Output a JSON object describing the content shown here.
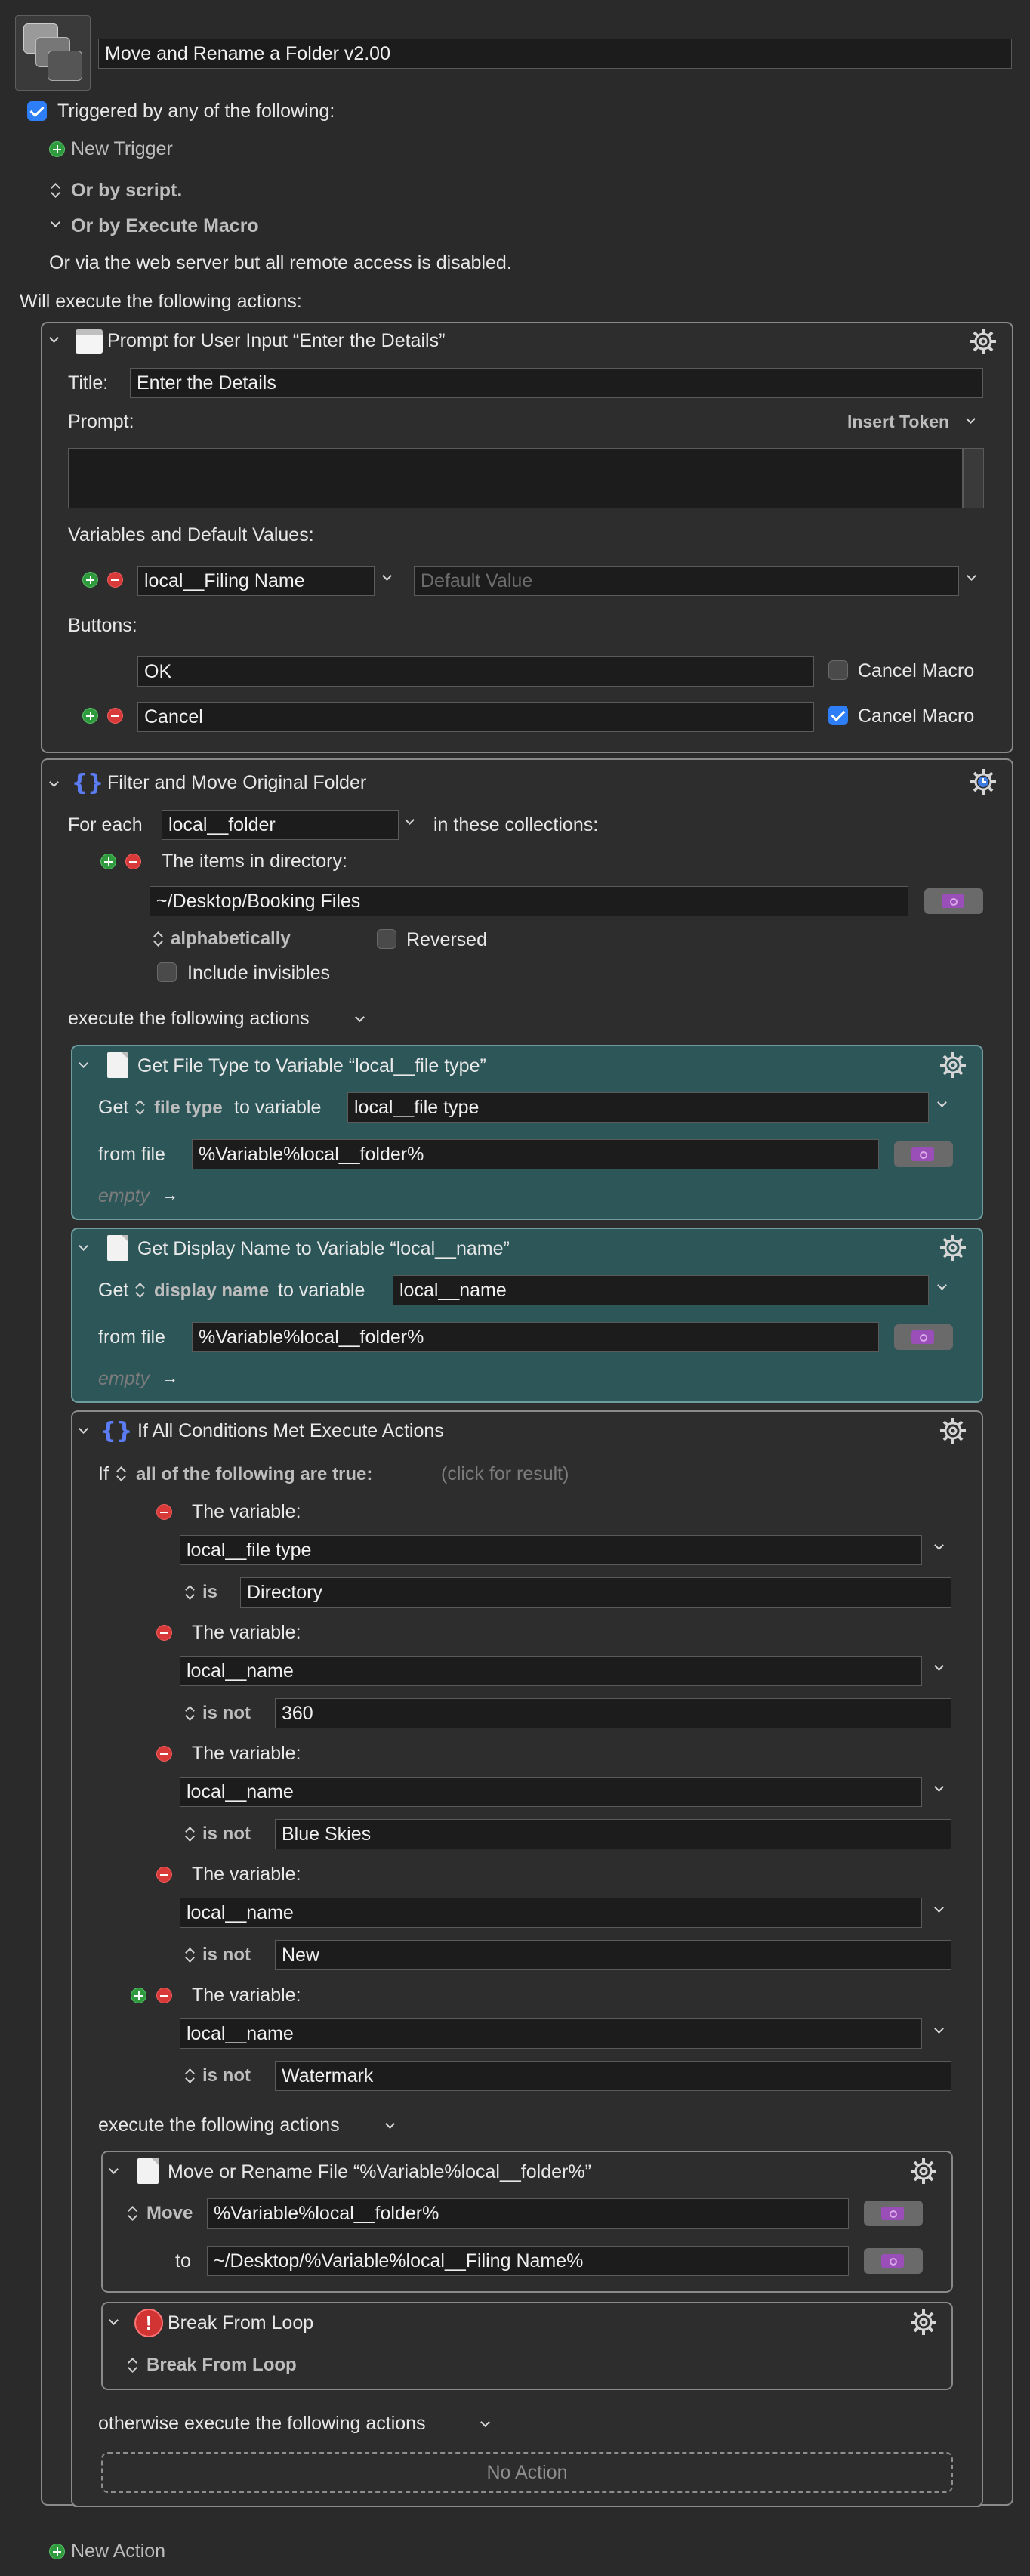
{
  "macro": {
    "name": "Move and Rename a Folder v2.00",
    "triggered_label": "Triggered by any of the following:",
    "new_trigger": "New Trigger",
    "or_by_script": "Or by script.",
    "or_by_execute_macro": "Or by Execute Macro",
    "web_server_note": "Or via the web server but all remote access is disabled.",
    "will_execute": "Will execute the following actions:",
    "new_action": "New Action"
  },
  "prompt_action": {
    "title": "Prompt for User Input “Enter the Details”",
    "title_label": "Title:",
    "title_value": "Enter the Details",
    "prompt_label": "Prompt:",
    "insert_token": "Insert Token",
    "vars_label": "Variables and Default Values:",
    "var_name": "local__Filing Name",
    "default_placeholder": "Default Value",
    "buttons_label": "Buttons:",
    "button1": "OK",
    "button2": "Cancel",
    "cancel_macro": "Cancel Macro",
    "cancel_macro_2": "Cancel Macro"
  },
  "foreach_action": {
    "title": "Filter and Move Original Folder",
    "for_each": "For each",
    "var": "local__folder",
    "in_collections": "in these collections:",
    "items_in_dir": "The items in directory:",
    "dir_path": "~/Desktop/Booking Files",
    "sort": "alphabetically",
    "reversed": "Reversed",
    "include_invisibles": "Include invisibles",
    "execute_following": "execute the following actions"
  },
  "get_file_type": {
    "title": "Get File Type to Variable “local__file type”",
    "get": "Get",
    "attr": "file type",
    "to_variable": "to variable",
    "var": "local__file type",
    "from_file": "from file",
    "file_value": "%Variable%local__folder%",
    "empty": "empty"
  },
  "get_display_name": {
    "title": "Get Display Name to Variable “local__name”",
    "get": "Get",
    "attr": "display name",
    "to_variable": "to variable",
    "var": "local__name",
    "from_file": "from file",
    "file_value": "%Variable%local__folder%",
    "empty": "empty"
  },
  "if_action": {
    "title": "If All Conditions Met Execute Actions",
    "if": "If",
    "all_following": "all of the following are true:",
    "click_result": "(click for result)",
    "the_variable": "The variable:",
    "conditions": [
      {
        "var": "local__file type",
        "op": "is",
        "value": "Directory"
      },
      {
        "var": "local__name",
        "op": "is not",
        "value": "360"
      },
      {
        "var": "local__name",
        "op": "is not",
        "value": "Blue Skies"
      },
      {
        "var": "local__name",
        "op": "is not",
        "value": "New"
      },
      {
        "var": "local__name",
        "op": "is not",
        "value": "Watermark"
      }
    ],
    "execute_following": "execute the following actions",
    "otherwise": "otherwise execute the following actions",
    "no_action": "No Action"
  },
  "move_action": {
    "title": "Move or Rename File “%Variable%local__folder%”",
    "op": "Move",
    "source": "%Variable%local__folder%",
    "to": "to",
    "dest": "~/Desktop/%Variable%local__Filing Name%"
  },
  "break_action": {
    "title": "Break From Loop",
    "sub": "Break From Loop"
  },
  "colors": {
    "background": "#2a2a2a",
    "teal_action": "#2d5659",
    "field": "#1c1c1c",
    "accent_blue": "#2d7ef7",
    "add_green": "#2f9a3e",
    "remove_red": "#d83a3a"
  }
}
